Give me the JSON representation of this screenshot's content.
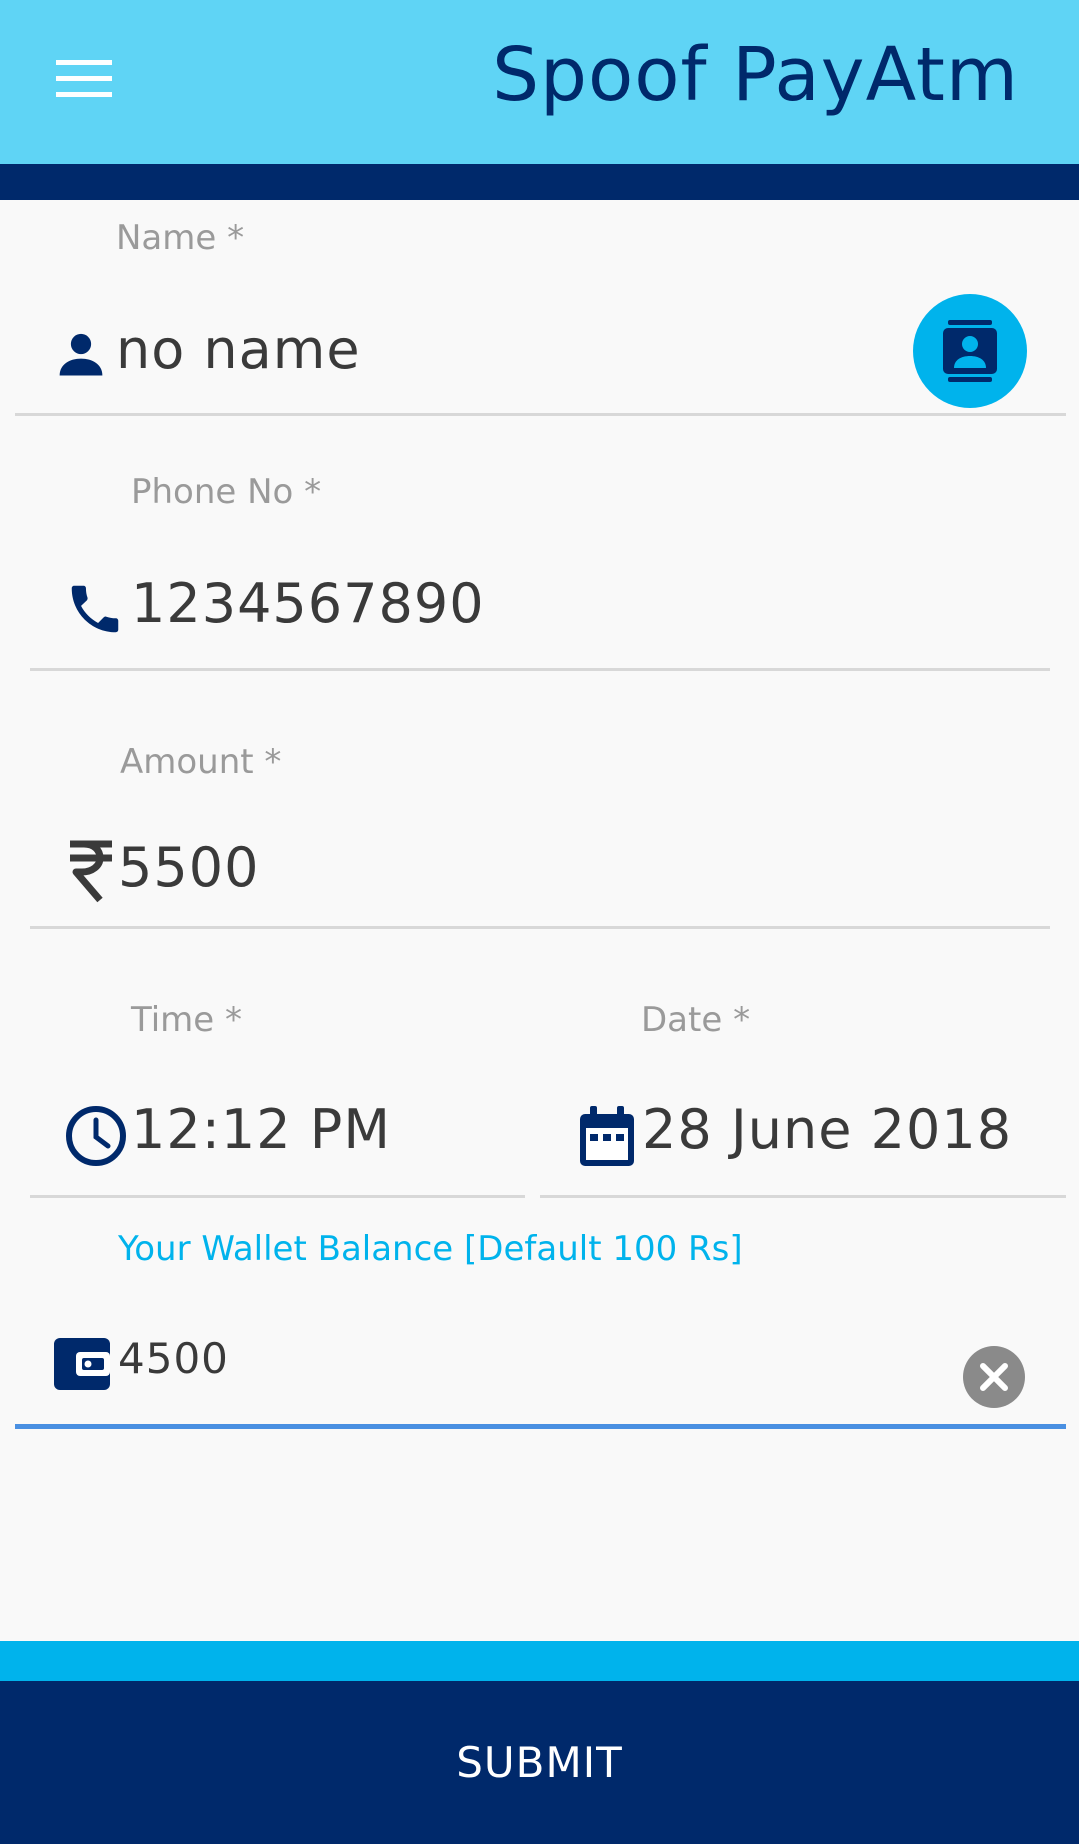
{
  "header": {
    "title": "Spoof PayAtm",
    "menu_icon": "menu-icon"
  },
  "form": {
    "name": {
      "label": "Name *",
      "value": "no name",
      "icon": "person-icon",
      "action_icon": "contact-book-icon"
    },
    "phone": {
      "label": "Phone No *",
      "value": "1234567890",
      "icon": "phone-icon"
    },
    "amount": {
      "label": "Amount *",
      "value": "5500",
      "icon": "rupee-icon"
    },
    "time": {
      "label": "Time *",
      "value": "12:12 PM",
      "icon": "clock-icon"
    },
    "date": {
      "label": "Date *",
      "value": "28 June 2018",
      "icon": "calendar-icon"
    },
    "wallet": {
      "label": "Your Wallet Balance [Default 100 Rs]",
      "value": "4500",
      "icon": "wallet-icon",
      "clear_icon": "clear-icon"
    }
  },
  "submit": {
    "label": "SUBMIT"
  },
  "colors": {
    "header_bg": "#5fd4f5",
    "primary_dark": "#00296b",
    "accent": "#00b3ec",
    "focus_underline": "#4a90e2",
    "label_gray": "#9a9a9a"
  }
}
